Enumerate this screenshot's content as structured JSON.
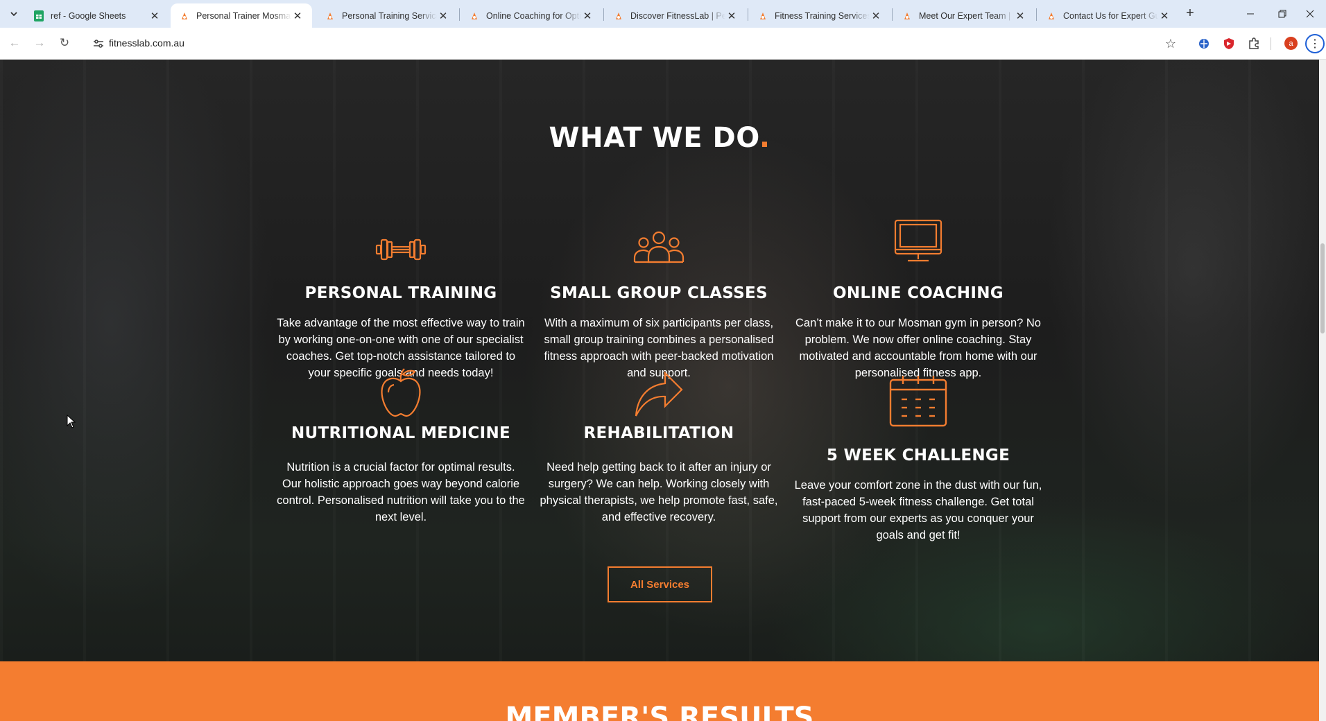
{
  "browser": {
    "tabs": [
      {
        "title": "ref - Google Sheets",
        "favicon": "sheets-icon",
        "active": false
      },
      {
        "title": "Personal Trainer Mosman",
        "favicon": "fitnesslab-icon",
        "active": true
      },
      {
        "title": "Personal Training Services",
        "favicon": "fitnesslab-icon",
        "active": false
      },
      {
        "title": "Online Coaching for Optimal",
        "favicon": "fitnesslab-icon",
        "active": false
      },
      {
        "title": "Discover FitnessLab | Personal",
        "favicon": "fitnesslab-icon",
        "active": false
      },
      {
        "title": "Fitness Training Services | FitnessLab",
        "favicon": "fitnesslab-icon",
        "active": false
      },
      {
        "title": "Meet Our Expert Team | FitnessLab",
        "favicon": "fitnesslab-icon",
        "active": false
      },
      {
        "title": "Contact Us for Expert Guidance",
        "favicon": "fitnesslab-icon",
        "active": false
      }
    ],
    "url": "fitnesslab.com.au",
    "profile_initial": "a",
    "accent_color": "#1d5fd6"
  },
  "page": {
    "section_title": "WHAT WE DO",
    "section_title_dot": ".",
    "accent_color": "#f47d30",
    "services": [
      {
        "icon": "dumbbell-icon",
        "title": "PERSONAL TRAINING",
        "text": "Take advantage of the most effective way to train by working one-on-one with one of our specialist coaches. Get top-notch assistance tailored to your specific goals and needs today!"
      },
      {
        "icon": "group-icon",
        "title": "SMALL GROUP CLASSES",
        "text": "With a maximum of six participants per class, small group training combines a personalised fitness approach with peer-backed motivation and support."
      },
      {
        "icon": "monitor-icon",
        "title": "ONLINE COACHING",
        "text": "Can’t make it to our Mosman gym in person? No problem. We now offer online coaching. Stay motivated and accountable from home with our personalised fitness app."
      },
      {
        "icon": "apple-icon",
        "title": "NUTRITIONAL MEDICINE",
        "text": "Nutrition is a crucial factor for optimal results. Our holistic approach goes way beyond calorie control. Personalised nutrition will take you to the next level."
      },
      {
        "icon": "forward-arrow-icon",
        "title": "REHABILITATION",
        "text": "Need help getting back to it after an injury or surgery? We can help. Working closely with physical therapists, we help promote fast, safe, and effective recovery."
      },
      {
        "icon": "calendar-icon",
        "title": "5 WEEK CHALLENGE",
        "text": "Leave your comfort zone in the dust with our fun, fast-paced 5-week fitness challenge. Get total support from our experts as you conquer your goals and get fit!"
      }
    ],
    "all_services_label": "All Services",
    "results_title": "MEMBER'S RESULTS"
  }
}
